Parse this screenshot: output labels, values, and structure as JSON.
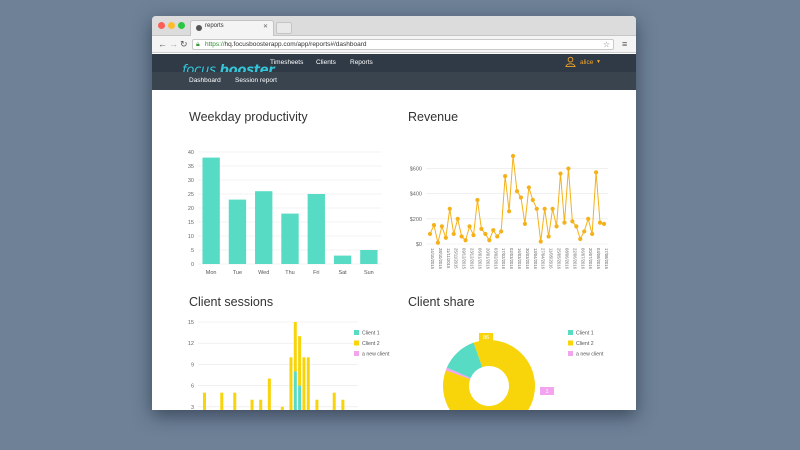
{
  "browser": {
    "tab_title": "reports",
    "url_scheme": "https://",
    "url_rest": "hq.focusboosterapp.com/app/reports#/dashboard"
  },
  "app": {
    "logo_light": "focus",
    "logo_bold": "booster",
    "nav": [
      "Timesheets",
      "Clients",
      "Reports"
    ],
    "user": "alice",
    "subnav": [
      "Dashboard",
      "Session report"
    ]
  },
  "panels": {
    "weekday_title": "Weekday productivity",
    "revenue_title": "Revenue",
    "sessions_title": "Client sessions",
    "share_title": "Client share"
  },
  "colors": {
    "teal": "#58dbc4",
    "yellow": "#f8d50b",
    "orange": "#f5b11a",
    "pink": "#f3a4ee"
  },
  "chart_data": [
    {
      "type": "bar",
      "categories": [
        "Mon",
        "Tue",
        "Wed",
        "Thu",
        "Fri",
        "Sat",
        "Sun"
      ],
      "values": [
        38,
        23,
        26,
        18,
        25,
        3,
        5
      ],
      "ylim": [
        0,
        40
      ],
      "yticks": [
        0,
        5,
        10,
        15,
        20,
        25,
        30,
        35,
        40
      ],
      "grid": true
    },
    {
      "type": "line",
      "x": [
        "14/10/2015",
        "21/10/2015",
        "28/10/2015",
        "04/11/2015",
        "11/11/2015",
        "18/11/2015",
        "25/11/2015",
        "02/12/2015",
        "09/12/2015",
        "16/12/2015",
        "23/12/2015",
        "30/12/2015",
        "06/01/2016",
        "13/01/2016",
        "20/01/2016",
        "27/01/2016",
        "03/02/2016",
        "10/02/2016",
        "17/02/2016",
        "24/02/2016",
        "02/03/2016",
        "09/03/2016",
        "16/03/2016",
        "23/03/2016",
        "30/03/2016",
        "06/04/2016",
        "13/04/2016",
        "20/04/2016",
        "27/04/2016",
        "04/05/2016",
        "11/05/2016",
        "18/05/2016",
        "25/05/2016",
        "01/06/2016",
        "08/06/2016",
        "15/06/2016",
        "22/06/2016",
        "29/06/2016",
        "06/07/2016",
        "13/07/2016",
        "20/07/2016",
        "27/07/2016",
        "03/08/2016",
        "10/08/2016",
        "17/08/2016"
      ],
      "xtick_labels": [
        "14/10/2015",
        "21/10/2015",
        "28/10/2015",
        "04/11/2015",
        "11/11/2015",
        "18/11/2015",
        "25/11/2015",
        "02/12/2015",
        "09/12/2015",
        "16/12/2015",
        "23/12/2015",
        "30/12/2015",
        "06/01/2016",
        "13/01/2016",
        "20/01/2016",
        "27/01/2016",
        "03/02/2016",
        "10/02/2016",
        "17/02/2016",
        "24/02/2016",
        "02/03/2016",
        "09/03/2016",
        "16/03/2016",
        "23/03/2016",
        "30/03/2016",
        "06/04/2016",
        "13/04/2016",
        "20/04/2016",
        "27/04/2016",
        "04/05/2016",
        "11/05/2016",
        "18/05/2016",
        "25/05/2016",
        "01/06/2016",
        "08/06/2016",
        "15/06/2016",
        "22/06/2016",
        "29/06/2016",
        "06/07/2016",
        "13/07/2016",
        "20/07/2016",
        "27/07/2016",
        "03/08/2016",
        "10/08/2016",
        "17/08/2016"
      ],
      "xtick_display": [
        "14/10/2015",
        "21/10/2015",
        "28/10/2015",
        "04/11/2015",
        "11/11/2015",
        "18/11/2015",
        "25/11/2015",
        "02/12/2015",
        "09/12/2015",
        "16/12/2015",
        "23/12/2015",
        "30/12/2015",
        "06/01/2016",
        "13/01/2016",
        "20/01/2016",
        "27/01/2016",
        "03/02/2016",
        "10/02/2016",
        "17/02/2016",
        "24/02/2016",
        "02/03/2016",
        "09/03/2016",
        "16/03/2016",
        "23/03/2016",
        "30/03/2016",
        "06/04/2016",
        "13/04/2016",
        "20/04/2016",
        "27/04/2016",
        "04/05/2016",
        "11/05/2016",
        "18/05/2016",
        "25/05/2016",
        "01/06/2016",
        "08/06/2016",
        "15/06/2016",
        "22/06/2016",
        "29/06/2016",
        "06/07/2016",
        "13/07/2016",
        "20/07/2016",
        "27/07/2016",
        "03/08/2016",
        "10/08/2016",
        "17/08/2016"
      ],
      "values": [
        80,
        150,
        10,
        140,
        50,
        280,
        80,
        200,
        60,
        30,
        140,
        70,
        350,
        120,
        80,
        30,
        110,
        60,
        100,
        540,
        260,
        700,
        420,
        370,
        160,
        450,
        350,
        280,
        20,
        280,
        60,
        280,
        140,
        560,
        170,
        600,
        180,
        140,
        40,
        100,
        200,
        80,
        570,
        170,
        160
      ],
      "ylim": [
        0,
        700
      ],
      "yticks": [
        0,
        200,
        400,
        600
      ],
      "ytick_labels": [
        "$0",
        "$200",
        "$400",
        "$600"
      ],
      "grid": true
    },
    {
      "type": "bar",
      "stacked": true,
      "ylim": [
        0,
        15
      ],
      "yticks": [
        0,
        3,
        6,
        9,
        12,
        15
      ],
      "legend": [
        "Client 1",
        "Client 2",
        "a new client"
      ],
      "legend_position": "top-right",
      "series": [
        {
          "name": "Client 1",
          "values": [
            1,
            1,
            0,
            0,
            1,
            0,
            0,
            1,
            0,
            1,
            0,
            1,
            0,
            0,
            0,
            0,
            1,
            1,
            0,
            1,
            0,
            2,
            8,
            6,
            1,
            2,
            0,
            0,
            0,
            0,
            1,
            0,
            0,
            0,
            2,
            1,
            0
          ]
        },
        {
          "name": "Client 2",
          "values": [
            0,
            4,
            0,
            0,
            0,
            5,
            0,
            0,
            5,
            0,
            0,
            0,
            4,
            0,
            4,
            0,
            6,
            0,
            0,
            2,
            0,
            8,
            7,
            7,
            9,
            8,
            1,
            4,
            0,
            0,
            0,
            5,
            2,
            4,
            0,
            0,
            0
          ]
        },
        {
          "name": "a new client",
          "values": [
            0,
            0,
            0,
            0,
            0,
            0,
            0,
            0,
            0,
            0,
            0,
            0,
            0,
            0,
            0,
            0,
            0,
            0,
            0,
            0,
            0,
            0,
            0,
            0,
            0,
            0,
            0,
            0,
            0,
            0,
            1,
            0,
            0,
            0,
            0,
            0,
            0
          ]
        }
      ],
      "grid": true
    },
    {
      "type": "pie",
      "donut": true,
      "labels": [
        "Client 1",
        "Client 2",
        "a new client"
      ],
      "values": [
        13,
        86,
        1
      ],
      "data_labels": [
        "",
        "86",
        "1"
      ],
      "legend": [
        "Client 1",
        "Client 2",
        "a new client"
      ],
      "legend_position": "top-right"
    }
  ]
}
